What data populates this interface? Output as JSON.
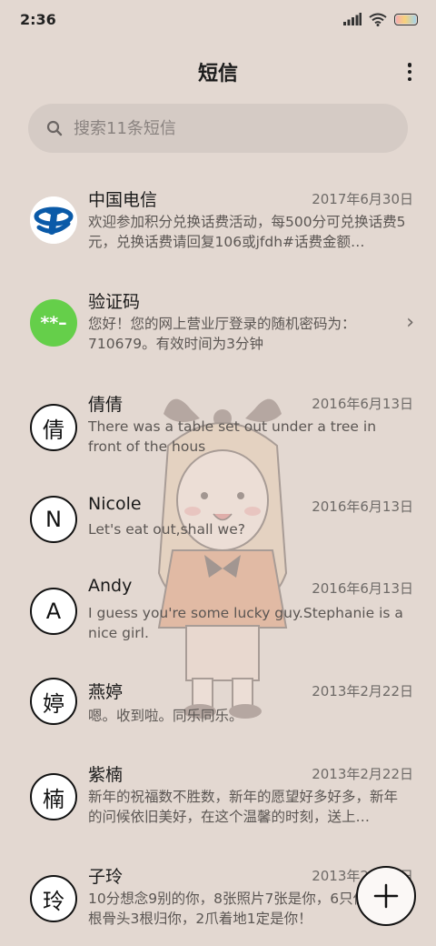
{
  "status": {
    "time": "2:36"
  },
  "header": {
    "title": "短信"
  },
  "search": {
    "placeholder": "搜索11条短信"
  },
  "messages": [
    {
      "name": "中国电信",
      "date": "2017年6月30日",
      "preview": "欢迎参加积分兑换话费活动，每500分可兑换话费5元，兑换话费请回复106或jfdh#话费金额…",
      "avatar": "telecom-logo"
    },
    {
      "name": "验证码",
      "date": "",
      "preview": "您好！您的网上营业厅登录的随机密码为：710679。有效时间为3分钟",
      "avatar": "**–"
    },
    {
      "name": "倩倩",
      "date": "2016年6月13日",
      "preview": "There was a table set out under a tree in front of the hous",
      "avatar": "倩"
    },
    {
      "name": "Nicole",
      "date": "2016年6月13日",
      "preview": "Let's eat out,shall we?",
      "avatar": "N"
    },
    {
      "name": "Andy",
      "date": "2016年6月13日",
      "preview": "I guess you're some lucky guy.Stephanie is a nice girl.",
      "avatar": "A"
    },
    {
      "name": "燕婷",
      "date": "2013年2月22日",
      "preview": "嗯。收到啦。同乐同乐。",
      "avatar": "婷"
    },
    {
      "name": "紫楠",
      "date": "2013年2月22日",
      "preview": "新年的祝福数不胜数，新年的愿望好多好多，新年的问候依旧美好，在这个温馨的时刻，送上…",
      "avatar": "楠"
    },
    {
      "name": "子玲",
      "date": "2013年2月22日",
      "preview": "10分想念9别的你，8张照片7张是你，6只像你，4根骨头3根归你，2爪着地1定是你！",
      "avatar": "玲"
    }
  ],
  "colors": {
    "background": "#e3d8d1",
    "search_bg": "#d5cbc5",
    "code_avatar": "#65cf4a",
    "telecom_blue": "#0a5aa8"
  },
  "icons": {
    "search": "search-icon",
    "more": "more-vertical-icon",
    "fab": "plus-icon",
    "chevron": "chevron-right-icon"
  }
}
